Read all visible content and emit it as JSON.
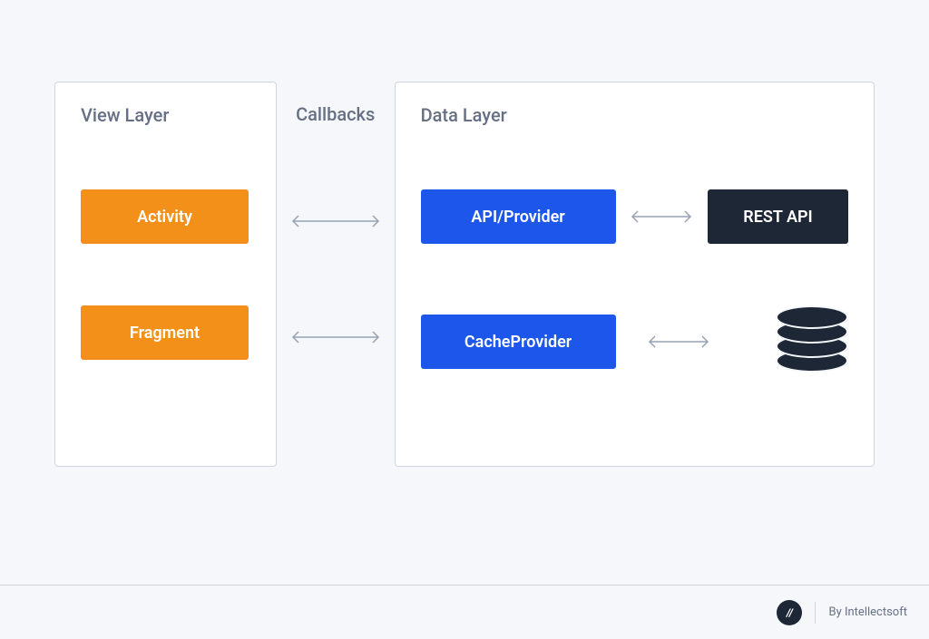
{
  "viewLayer": {
    "title": "View Layer",
    "activity": "Activity",
    "fragment": "Fragment"
  },
  "callbacks": {
    "label": "Callbacks"
  },
  "dataLayer": {
    "title": "Data Layer",
    "apiProvider": "API/Provider",
    "restApi": "REST API",
    "cacheProvider": "CacheProvider"
  },
  "footer": {
    "byText": "By Intellectsoft",
    "logoText": "//"
  },
  "colors": {
    "orange": "#f39019",
    "blue": "#1c56ea",
    "dark": "#1e2735",
    "textGray": "#667085",
    "border": "#d0d5dd",
    "background": "#f5f7fa"
  }
}
